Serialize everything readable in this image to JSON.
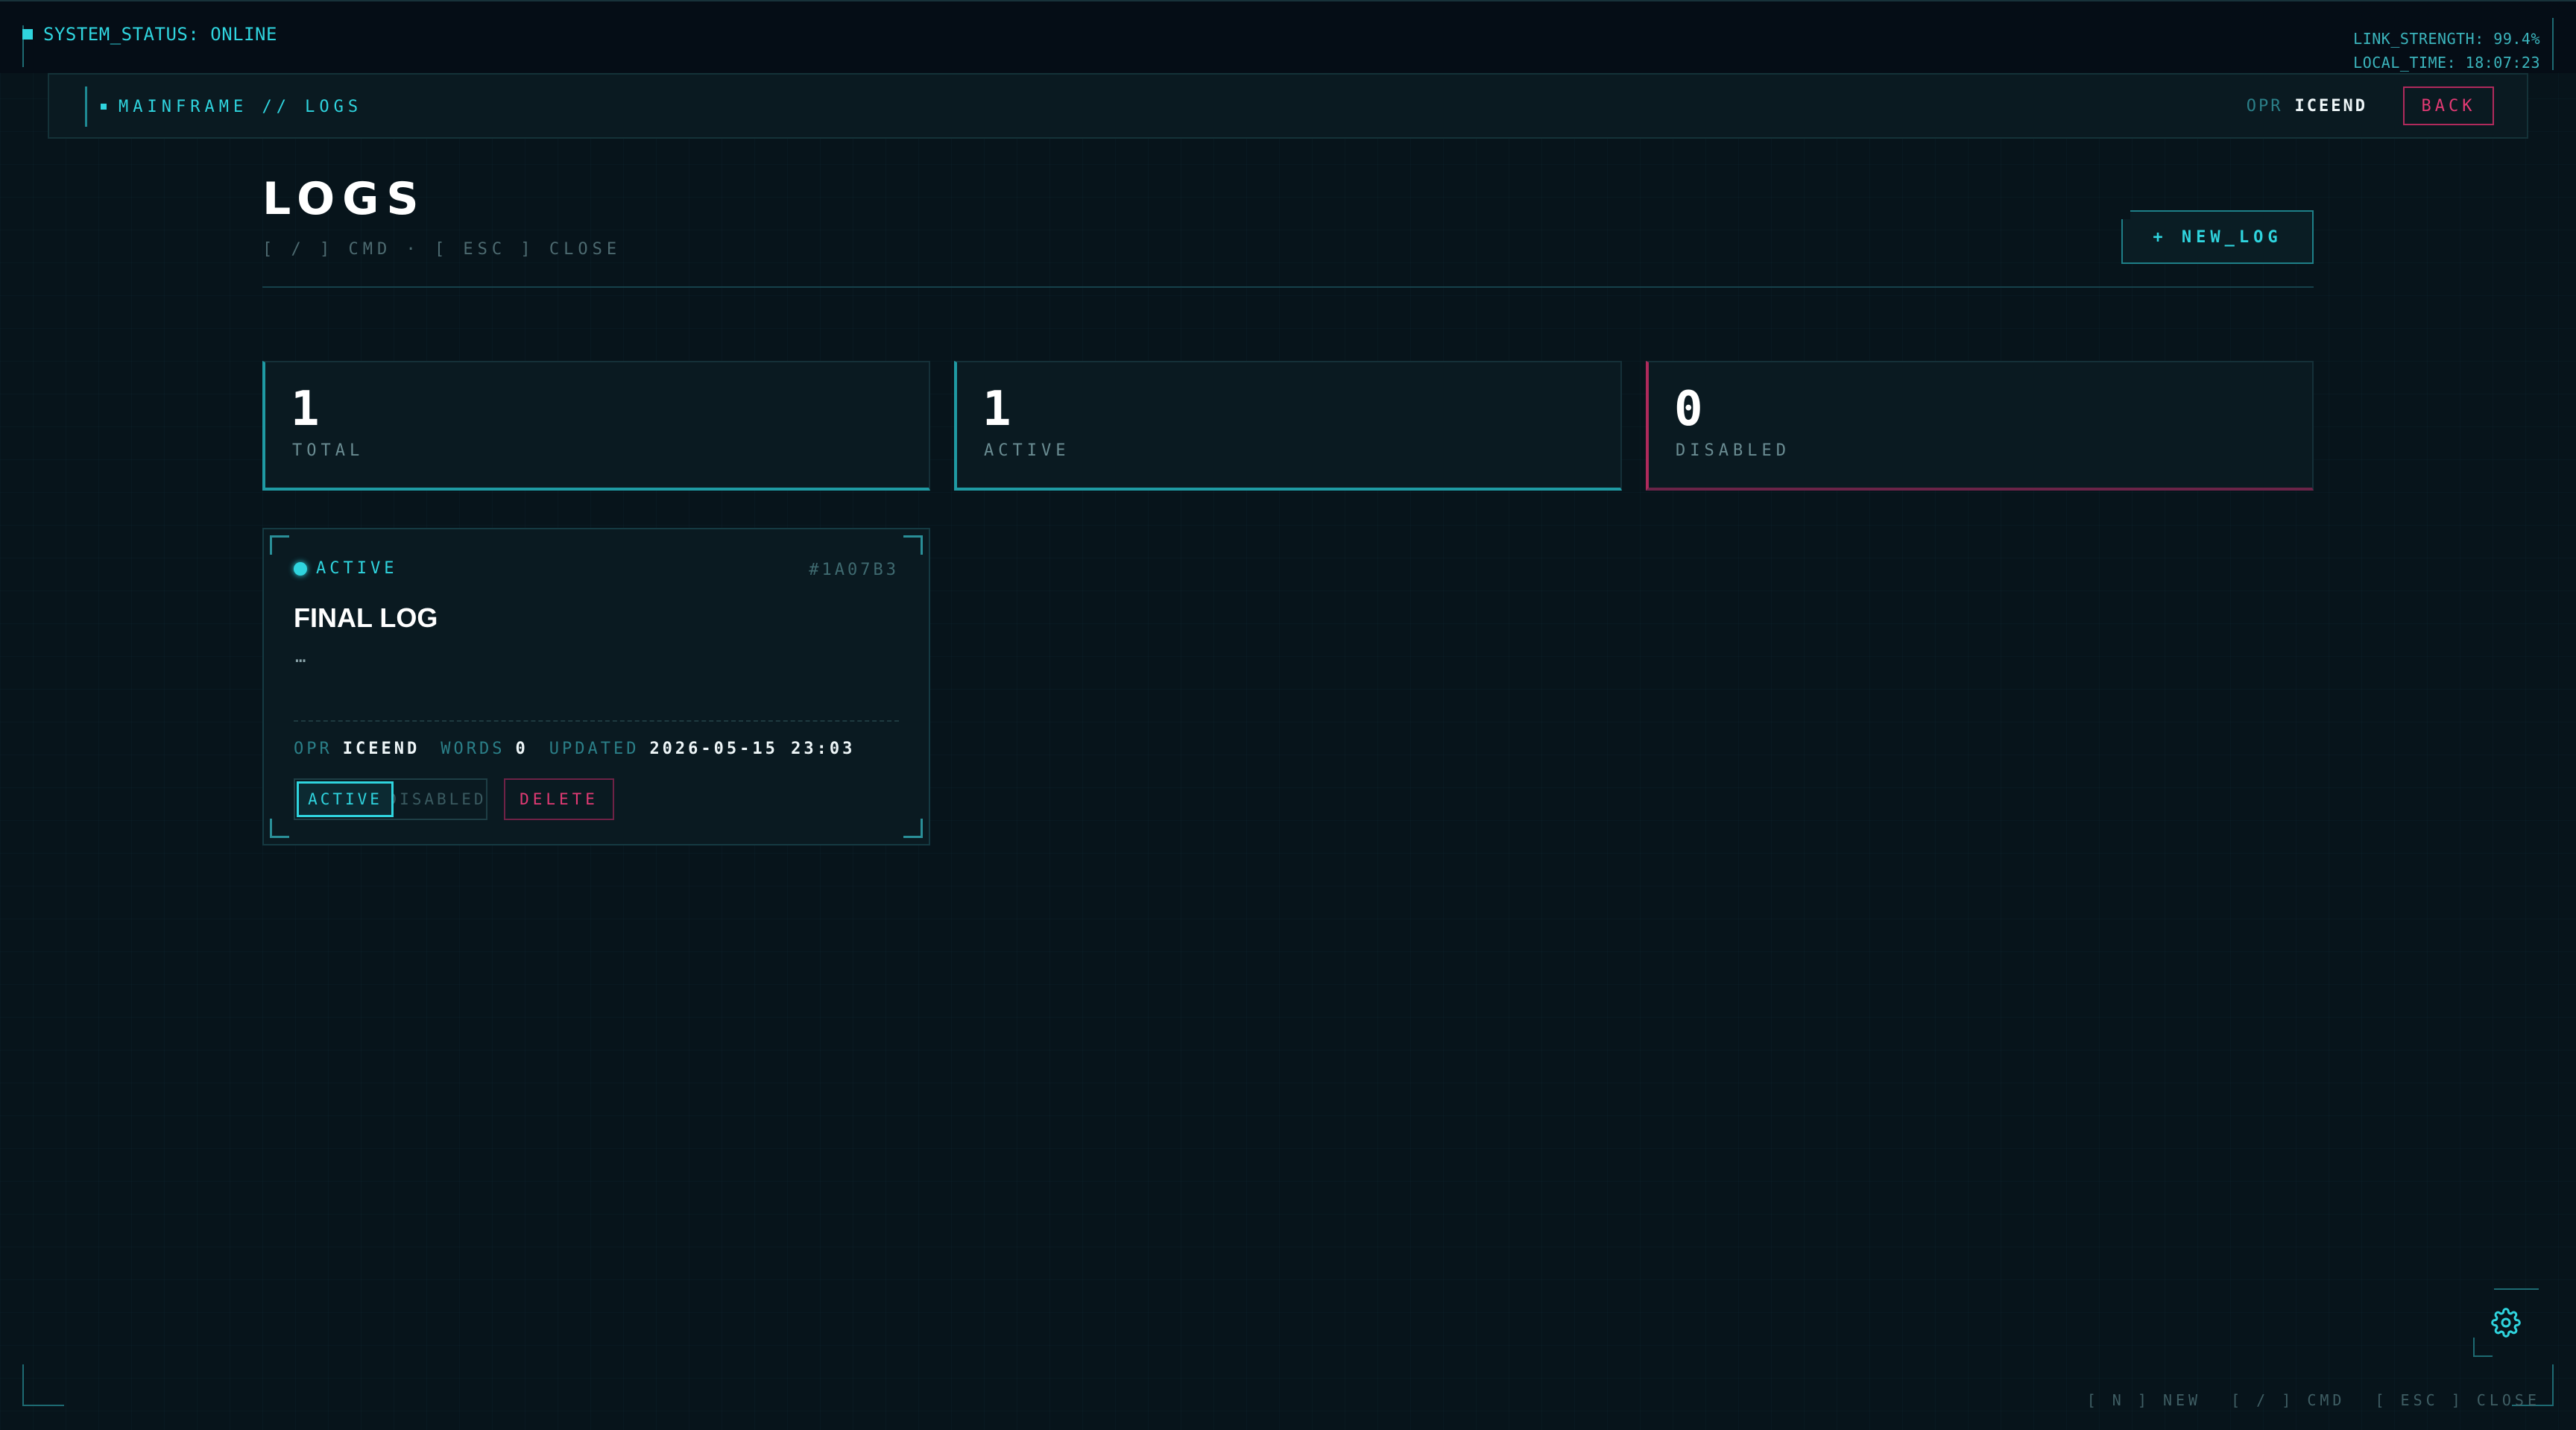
{
  "system": {
    "status": "SYSTEM_STATUS: ONLINE",
    "link_strength": "LINK_STRENGTH: 99.4%",
    "local_time": "LOCAL_TIME: 18:07:23"
  },
  "nav": {
    "breadcrumb": "MAINFRAME // LOGS",
    "operator_label": "OPR",
    "operator_name": "ICEEND",
    "back_label": "BACK"
  },
  "header": {
    "title": "LOGS",
    "hint": "[ / ] CMD · [ ESC ] CLOSE",
    "new_button": "+ NEW_LOG"
  },
  "stats": [
    {
      "value": "1",
      "label": "TOTAL"
    },
    {
      "value": "1",
      "label": "ACTIVE"
    },
    {
      "value": "0",
      "label": "DISABLED"
    }
  ],
  "logs": [
    {
      "status": "ACTIVE",
      "hash": "#1A07B3",
      "title": "FINAL LOG",
      "excerpt": "…",
      "opr_label": "OPR",
      "opr_value": "ICEEND",
      "words_label": "WORDS",
      "words_value": "0",
      "updated_label": "UPDATED",
      "updated_value": "2026-05-15 23:03",
      "toggle_active": "ACTIVE",
      "toggle_disabled": "DISABLED",
      "delete_label": "DELETE"
    }
  ],
  "footer": {
    "shortcut_new": "[ N ] NEW",
    "shortcut_cmd": "[ / ] CMD",
    "shortcut_close": "[ ESC ] CLOSE",
    "settings_icon": "gear-icon"
  },
  "colors": {
    "accent": "#2fd4de",
    "danger": "#e23a74",
    "background": "#07141b"
  }
}
